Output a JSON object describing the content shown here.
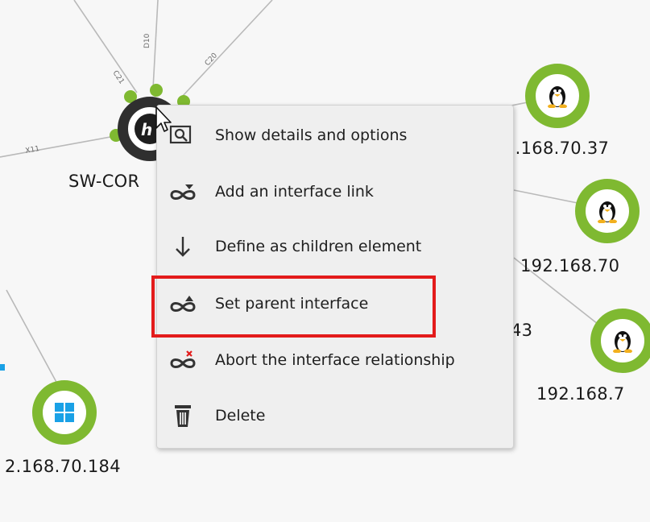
{
  "nodes": [
    {
      "id": "sw-core",
      "label": "SW-COR",
      "icon": "hp-logo-icon"
    },
    {
      "id": "linux-37",
      "label": "2.168.70.37",
      "icon": "linux-tux-icon"
    },
    {
      "id": "linux-70x",
      "label": "192.168.70",
      "icon": "linux-tux-icon"
    },
    {
      "id": "linux-7",
      "label": "192.168.7",
      "icon": "linux-tux-icon"
    },
    {
      "id": "windows-184",
      "label": "2.168.70.184",
      "icon": "windows-logo-icon"
    },
    {
      "id": "hidden-43",
      "label": "43"
    }
  ],
  "edge_labels": [
    "C21",
    "D10",
    "C20",
    "X11"
  ],
  "context_menu": {
    "items": [
      {
        "label": "Show details and options",
        "icon": "magnifier-details-icon"
      },
      {
        "label": "Add an interface link",
        "icon": "link-add-icon"
      },
      {
        "label": "Define as children element",
        "icon": "arrow-down-icon"
      },
      {
        "label": "Set parent interface",
        "icon": "link-parent-icon",
        "highlighted": true
      },
      {
        "label": "Abort the interface relationship",
        "icon": "link-abort-icon"
      },
      {
        "label": "Delete",
        "icon": "trash-icon"
      }
    ]
  },
  "colors": {
    "node_ring": "#7fb931",
    "switch_ring": "#2f2f2f",
    "highlight": "#e31b1b",
    "windows_blue": "#1aa1e6"
  }
}
